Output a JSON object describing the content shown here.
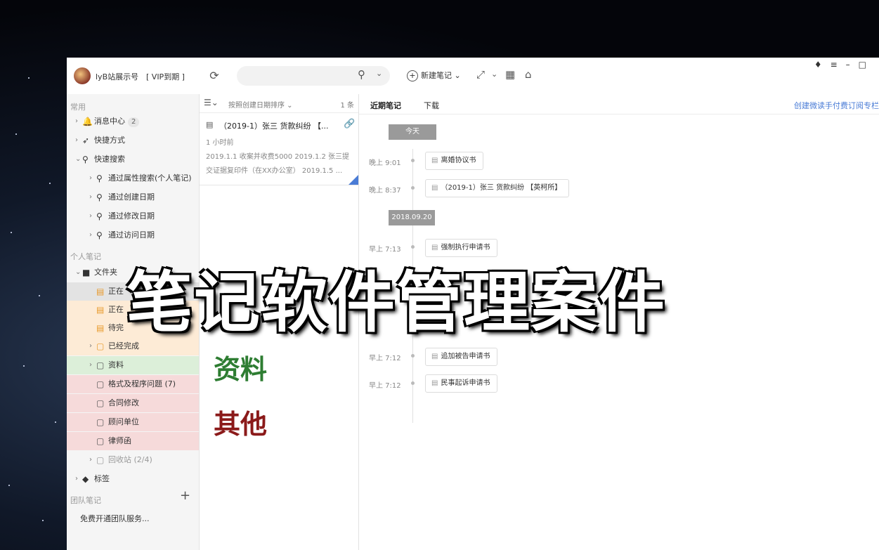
{
  "account": {
    "username": "lyB站展示号",
    "vip": "[ VIP到期 ]"
  },
  "toolbar": {
    "new_note_label": "新建笔记",
    "icons": [
      "sync-icon",
      "search-icon",
      "expand-icon",
      "grid-icon",
      "home-icon"
    ]
  },
  "window_controls": [
    "pin-icon",
    "menu-icon",
    "minimize-icon",
    "maximize-icon"
  ],
  "sidebar": {
    "section_common": "常用",
    "msg_center": {
      "label": "消息中心",
      "badge": "2"
    },
    "shortcuts": "快捷方式",
    "quick_search": "快速搜索",
    "search_attr": "通过属性搜索(个人笔记)",
    "search_created": "通过创建日期",
    "search_modified": "通过修改日期",
    "search_visited": "通过访问日期",
    "section_personal": "个人笔记",
    "folder_root": "文件夹",
    "folder_1": "正在",
    "folder_2": "正在",
    "folder_3": "待完",
    "folder_done": "已经完成",
    "folder_materials": "资料",
    "folder_format": "格式及程序问题 (7)",
    "folder_contract": "合同修改",
    "folder_advisor": "顾问单位",
    "folder_letter": "律师函",
    "folder_trash": "回收站 (2/4)",
    "tags": "标签",
    "section_team": "团队笔记",
    "team_open": "免费开通团队服务..."
  },
  "note_list": {
    "sort_label": "按照创建日期排序",
    "count": "1 条",
    "note": {
      "title": "（2019-1）张三 货款纠纷 【...",
      "time": "1 小时前",
      "snippet_1": "2019.1.1 收案并收费5000 2019.1.2 张三提",
      "snippet_2": "交证据复印件（在XX办公室） 2019.1.5 ..."
    }
  },
  "main": {
    "tab_recent": "近期笔记",
    "tab_download": "下载",
    "top_link": "创建微读手付费订阅专栏",
    "date_today": "今天",
    "date_2": "2018.09.20",
    "entries": [
      {
        "time": "晚上 9:01",
        "title": "离婚协议书"
      },
      {
        "time": "晚上 8:37",
        "title": "（2019-1）张三 货款纠纷 【英柯所】"
      },
      {
        "time": "早上 7:13",
        "title": "强制执行申请书"
      },
      {
        "time": "早上 7:12",
        "title": "追加被告申请书"
      },
      {
        "time": "早上 7:12",
        "title": "民事起诉申请书"
      }
    ]
  },
  "overlay": {
    "headline": "笔记软件管理案件",
    "label_materials": "资料",
    "label_other": "其他"
  },
  "colors": {
    "accent_blue": "#4a7cd6",
    "folder_orange_bg": "#fdebd6",
    "folder_green_bg": "#dcefd9",
    "folder_red_bg": "#f6dada",
    "materials_green": "#2e7d32",
    "other_red": "#8b1a1a"
  }
}
